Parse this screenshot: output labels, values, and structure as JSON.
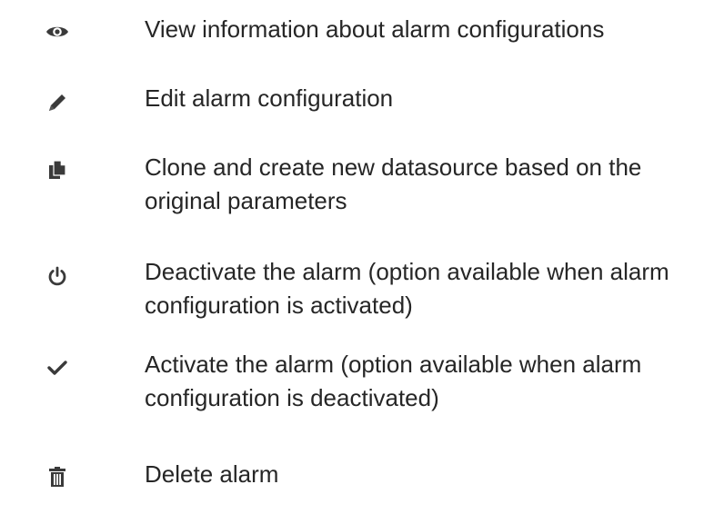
{
  "legend": {
    "items": [
      {
        "icon": "eye-icon",
        "text": "View information about alarm configurations"
      },
      {
        "icon": "pencil-icon",
        "text": "Edit alarm configuration"
      },
      {
        "icon": "copy-icon",
        "text": "Clone and create new datasource based on the original parameters"
      },
      {
        "icon": "power-icon",
        "text": "Deactivate the alarm (option available when alarm configuration is activated)"
      },
      {
        "icon": "checkmark-icon",
        "text": "Activate the alarm (option available when alarm configuration is deactivated)"
      },
      {
        "icon": "trash-icon",
        "text": "Delete alarm"
      }
    ]
  },
  "colors": {
    "icon": "#3a3a3a",
    "text": "#262626"
  }
}
